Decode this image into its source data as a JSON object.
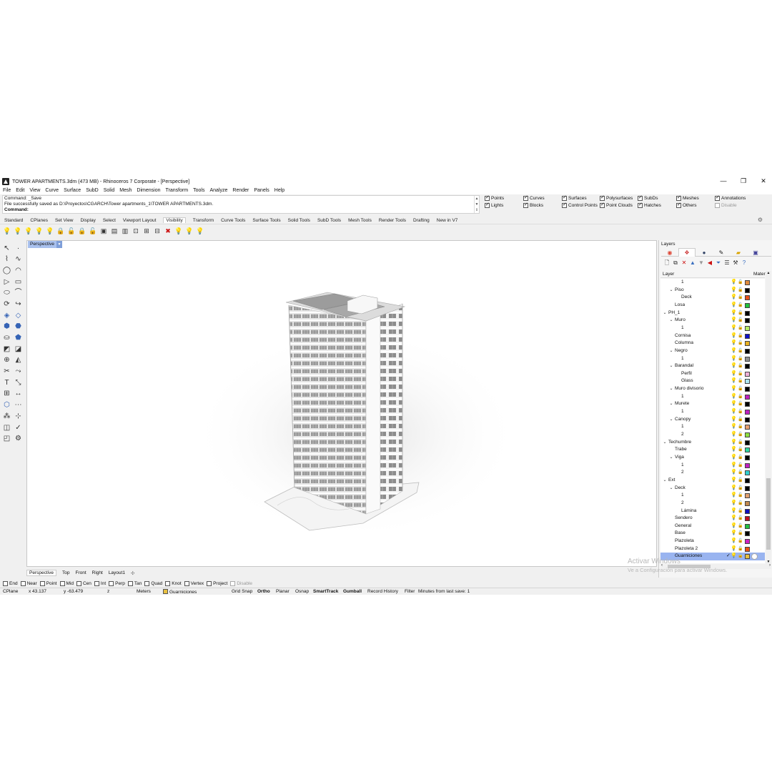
{
  "window": {
    "title": "TOWER APARTMENTS.3dm (473 MB) - Rhinoceros 7 Corporate - [Perspective]",
    "minimize": "—",
    "restore": "❐",
    "close": "✕"
  },
  "menu": [
    "File",
    "Edit",
    "View",
    "Curve",
    "Surface",
    "SubD",
    "Solid",
    "Mesh",
    "Dimension",
    "Transform",
    "Tools",
    "Analyze",
    "Render",
    "Panels",
    "Help"
  ],
  "command": {
    "history_1": "Command: _Save",
    "history_2": "File successfully saved as D:\\Proyectos\\CGARCH\\Tower apartments_1\\TOWER APARTMENTS.3dm.",
    "prompt": "Command:"
  },
  "filters": [
    {
      "label": "Points",
      "checked": true
    },
    {
      "label": "Lights",
      "checked": true
    },
    {
      "label": "Curves",
      "checked": true
    },
    {
      "label": "Blocks",
      "checked": true
    },
    {
      "label": "Surfaces",
      "checked": true
    },
    {
      "label": "Control Points",
      "checked": true
    },
    {
      "label": "Polysurfaces",
      "checked": true
    },
    {
      "label": "Point Clouds",
      "checked": true
    },
    {
      "label": "SubDs",
      "checked": true
    },
    {
      "label": "Hatches",
      "checked": true
    },
    {
      "label": "Meshes",
      "checked": true
    },
    {
      "label": "Others",
      "checked": true
    },
    {
      "label": "Annotations",
      "checked": true
    },
    {
      "label": "Disable",
      "checked": false
    }
  ],
  "toolbar_tabs": [
    "Standard",
    "CPlanes",
    "Set View",
    "Display",
    "Select",
    "Viewport Layout",
    "Visibility",
    "Transform",
    "Curve Tools",
    "Surface Tools",
    "Solid Tools",
    "SubD Tools",
    "Mesh Tools",
    "Render Tools",
    "Drafting",
    "New in V7"
  ],
  "active_tab": "Visibility",
  "viewport": {
    "name": "Perspective"
  },
  "view_tabs": [
    "Perspective",
    "Top",
    "Front",
    "Right",
    "Layout1"
  ],
  "view_tab_add": "✣",
  "osnaps": [
    {
      "label": "End",
      "checked": false
    },
    {
      "label": "Near",
      "checked": false
    },
    {
      "label": "Point",
      "checked": false
    },
    {
      "label": "Mid",
      "checked": false
    },
    {
      "label": "Cen",
      "checked": false
    },
    {
      "label": "Int",
      "checked": false
    },
    {
      "label": "Perp",
      "checked": false
    },
    {
      "label": "Tan",
      "checked": false
    },
    {
      "label": "Quad",
      "checked": false
    },
    {
      "label": "Knot",
      "checked": false
    },
    {
      "label": "Vertex",
      "checked": false
    },
    {
      "label": "Project",
      "checked": false
    },
    {
      "label": "Disable",
      "checked": false
    }
  ],
  "status": {
    "cplane": "CPlane",
    "x": "x 43.137",
    "y": "y -63.479",
    "z": "z",
    "units": "Meters",
    "layer": "Guarniciones",
    "grid_snap": "Grid Snap",
    "ortho": "Ortho",
    "planar": "Planar",
    "osnap": "Osnap",
    "smarttrack": "SmartTrack",
    "gumball": "Gumball",
    "record_history": "Record History",
    "filter": "Filter",
    "last_save": "Minutes from last save: 1"
  },
  "layers_panel": {
    "title": "Layers",
    "col_layer": "Layer",
    "col_material": "Mater",
    "rows": [
      {
        "name": "1",
        "indent": 3,
        "exp": "",
        "color": "#e08a3c"
      },
      {
        "name": "Piso",
        "indent": 2,
        "exp": "v",
        "color": "#000000"
      },
      {
        "name": "Deck",
        "indent": 3,
        "exp": "",
        "color": "#e8501a"
      },
      {
        "name": "Losa",
        "indent": 2,
        "exp": "",
        "color": "#22c23a"
      },
      {
        "name": "PH_1",
        "indent": 1,
        "exp": "v",
        "color": "#000000"
      },
      {
        "name": "Muro",
        "indent": 2,
        "exp": "v",
        "color": "#000000"
      },
      {
        "name": "1",
        "indent": 3,
        "exp": "",
        "color": "#b8ee66"
      },
      {
        "name": "Cornisa",
        "indent": 2,
        "exp": "",
        "color": "#1010c8"
      },
      {
        "name": "Columna",
        "indent": 2,
        "exp": "",
        "color": "#e8b020"
      },
      {
        "name": "Negro",
        "indent": 2,
        "exp": "v",
        "color": "#000000"
      },
      {
        "name": "1",
        "indent": 3,
        "exp": "",
        "color": "#909090"
      },
      {
        "name": "Barandal",
        "indent": 2,
        "exp": "v",
        "color": "#000000"
      },
      {
        "name": "Perfil",
        "indent": 3,
        "exp": "",
        "color": "#f0b0d8"
      },
      {
        "name": "Glass",
        "indent": 3,
        "exp": "",
        "color": "#b0e8f0"
      },
      {
        "name": "Muro divisorio",
        "indent": 2,
        "exp": "v",
        "color": "#000000"
      },
      {
        "name": "1",
        "indent": 3,
        "exp": "",
        "color": "#c020c0"
      },
      {
        "name": "Murete",
        "indent": 2,
        "exp": "v",
        "color": "#000000"
      },
      {
        "name": "1",
        "indent": 3,
        "exp": "",
        "color": "#c020c0"
      },
      {
        "name": "Canopy",
        "indent": 2,
        "exp": "v",
        "color": "#000000"
      },
      {
        "name": "1",
        "indent": 3,
        "exp": "",
        "color": "#e8a070"
      },
      {
        "name": "2",
        "indent": 3,
        "exp": "",
        "color": "#90e040"
      },
      {
        "name": "Techumbre",
        "indent": 1,
        "exp": "v",
        "color": "#000000"
      },
      {
        "name": "Trabe",
        "indent": 2,
        "exp": "",
        "color": "#30d8a0"
      },
      {
        "name": "Viga",
        "indent": 2,
        "exp": "v",
        "color": "#000000"
      },
      {
        "name": "1",
        "indent": 3,
        "exp": "",
        "color": "#c020c0"
      },
      {
        "name": "2",
        "indent": 3,
        "exp": "",
        "color": "#30d0d0"
      },
      {
        "name": "Ext",
        "indent": 1,
        "exp": "v",
        "color": "#000000"
      },
      {
        "name": "Deck",
        "indent": 2,
        "exp": "v",
        "color": "#000000"
      },
      {
        "name": "1",
        "indent": 3,
        "exp": "",
        "color": "#e0a070"
      },
      {
        "name": "2",
        "indent": 3,
        "exp": "",
        "color": "#c08850"
      },
      {
        "name": "Lámina",
        "indent": 3,
        "exp": "",
        "color": "#1010c0"
      },
      {
        "name": "Sendero",
        "indent": 2,
        "exp": "",
        "color": "#c01020"
      },
      {
        "name": "General",
        "indent": 2,
        "exp": "",
        "color": "#22c040"
      },
      {
        "name": "Base",
        "indent": 2,
        "exp": "",
        "color": "#000000"
      },
      {
        "name": "Plazoleta",
        "indent": 2,
        "exp": "",
        "color": "#d020c0"
      },
      {
        "name": "Plazoleta 2",
        "indent": 2,
        "exp": "",
        "color": "#e85010"
      },
      {
        "name": "Guarniciones",
        "indent": 2,
        "exp": "",
        "color": "#e8c040",
        "selected": true,
        "current": "✓"
      }
    ]
  },
  "watermark": {
    "line1": "Activar Windows",
    "line2": "Ve a Configuración para activar Windows."
  }
}
